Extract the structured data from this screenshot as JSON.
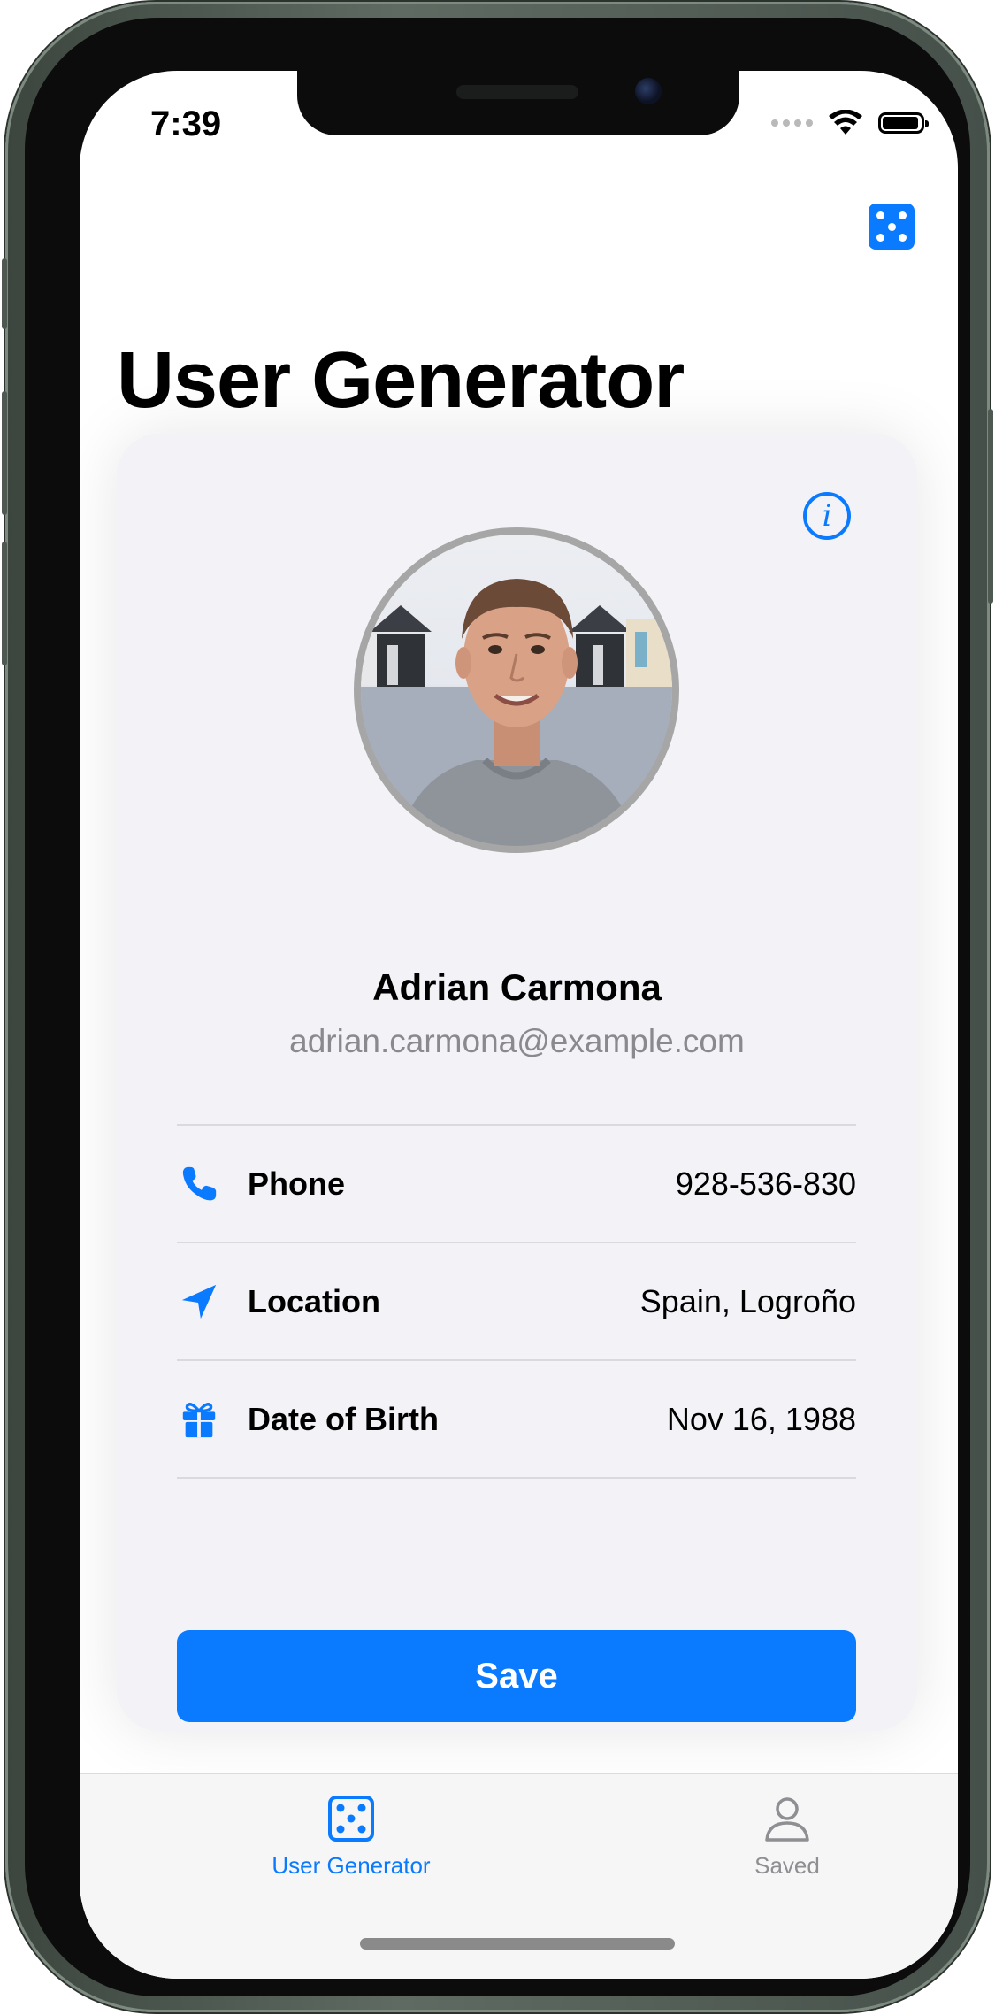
{
  "status_bar": {
    "time": "7:39",
    "wifi_icon": "wifi-icon",
    "battery_icon": "battery-icon"
  },
  "nav": {
    "title": "User Generator",
    "dice_icon": "dice-icon"
  },
  "card": {
    "info_icon": "info-circle-icon",
    "info_glyph": "i",
    "avatar_icon": "user-photo",
    "name": "Adrian Carmona",
    "email": "adrian.carmona@example.com",
    "rows": [
      {
        "icon": "phone-icon",
        "label": "Phone",
        "value": "928-536-830"
      },
      {
        "icon": "location-arrow-icon",
        "label": "Location",
        "value": "Spain, Logroño"
      },
      {
        "icon": "gift-icon",
        "label": "Date of Birth",
        "value": "Nov 16, 1988"
      }
    ],
    "save_label": "Save"
  },
  "tab_bar": {
    "tabs": [
      {
        "label": "User Generator",
        "icon": "dice-icon",
        "selected": true
      },
      {
        "label": "Saved",
        "icon": "person-icon",
        "selected": false
      }
    ]
  },
  "colors": {
    "accent": "#0a7aff",
    "card_background": "#f2f2f7",
    "secondary_text": "#8a8a8e",
    "tab_inactive": "#8e8e93"
  }
}
